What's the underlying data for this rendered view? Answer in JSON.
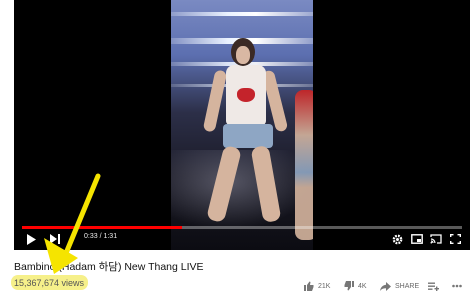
{
  "video": {
    "current_time": "0:33",
    "duration": "1:31",
    "progress": 0.363
  },
  "title": "Bambino (Hadam 하담) New Thang LIVE",
  "views": "15,367,674 views",
  "actions": {
    "like_count": "21K",
    "dislike_count": "4K",
    "share_label": "SHARE"
  },
  "colors": {
    "progress": "#ff0000",
    "highlight": "#f6f08a",
    "arrow": "#f5e400"
  },
  "icons": [
    "play-icon",
    "next-icon",
    "settings-icon",
    "miniplayer-icon",
    "cast-icon",
    "fullscreen-icon",
    "thumbs-up-icon",
    "thumbs-down-icon",
    "share-icon",
    "save-icon",
    "more-icon"
  ]
}
